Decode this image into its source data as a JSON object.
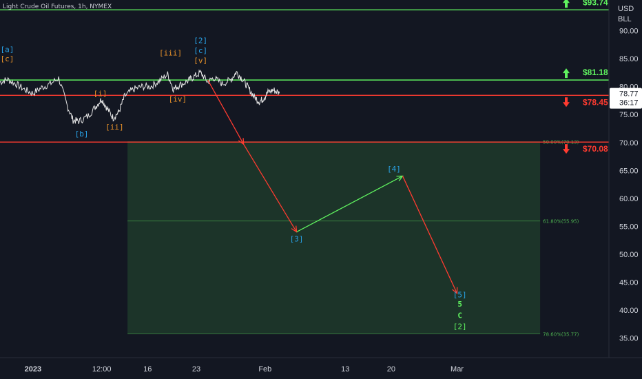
{
  "header": {
    "title": "Light Crude Oil Futures, 1h, NYMEX"
  },
  "price_axis": {
    "currency": "USD",
    "unit": "BLL"
  },
  "current_price": {
    "value": "78.77",
    "countdown": "36:17"
  },
  "colors": {
    "bg": "#131722",
    "green": "#5ff25f",
    "red": "#ff3b30",
    "blue": "#29a3e8",
    "orange": "#e7912a",
    "price": "#d1d4dc",
    "zone": "#1f3a2a"
  },
  "chart_data": {
    "type": "line",
    "ylim": [
      31.5,
      95.5
    ],
    "yticks": [
      35,
      40,
      45,
      50,
      55,
      60,
      65,
      70,
      75,
      80,
      85,
      90
    ],
    "xticks": [
      {
        "x": 0.6,
        "label": "2023"
      },
      {
        "x": 3.0,
        "label": "12:00"
      },
      {
        "x": 4.6,
        "label": "16"
      },
      {
        "x": 6.3,
        "label": "23"
      },
      {
        "x": 8.7,
        "label": "Feb"
      },
      {
        "x": 11.5,
        "label": "13"
      },
      {
        "x": 13.1,
        "label": "20"
      },
      {
        "x": 15.4,
        "label": "Mar"
      }
    ],
    "xlim": [
      -0.55,
      20.7
    ],
    "price_series": [
      [
        -0.55,
        80.8
      ],
      [
        -0.3,
        81.3
      ],
      [
        0.0,
        80.5
      ],
      [
        0.3,
        79.5
      ],
      [
        0.6,
        78.8
      ],
      [
        0.9,
        79.8
      ],
      [
        1.2,
        80.5
      ],
      [
        1.5,
        81.5
      ],
      [
        1.8,
        76.5
      ],
      [
        2.0,
        74.0
      ],
      [
        2.2,
        73.8
      ],
      [
        2.5,
        74.6
      ],
      [
        2.8,
        76.5
      ],
      [
        3.0,
        77.8
      ],
      [
        3.2,
        76.0
      ],
      [
        3.4,
        74.4
      ],
      [
        3.6,
        75.5
      ],
      [
        3.8,
        78.3
      ],
      [
        4.1,
        79.5
      ],
      [
        4.4,
        80.0
      ],
      [
        4.7,
        80.0
      ],
      [
        5.0,
        81.0
      ],
      [
        5.3,
        82.2
      ],
      [
        5.5,
        79.6
      ],
      [
        5.7,
        80.2
      ],
      [
        6.0,
        81.0
      ],
      [
        6.2,
        81.7
      ],
      [
        6.45,
        82.5
      ],
      [
        6.7,
        80.8
      ],
      [
        6.9,
        81.6
      ],
      [
        7.2,
        80.5
      ],
      [
        7.5,
        81.2
      ],
      [
        7.7,
        82.6
      ],
      [
        7.9,
        81.4
      ],
      [
        8.1,
        79.9
      ],
      [
        8.3,
        78.3
      ],
      [
        8.5,
        77.3
      ],
      [
        8.65,
        77.9
      ],
      [
        8.8,
        79.0
      ],
      [
        9.0,
        79.4
      ],
      [
        9.2,
        78.8
      ]
    ],
    "levels": [
      {
        "value": 93.74,
        "label": "$93.74",
        "color": "green",
        "arrow": "up"
      },
      {
        "value": 81.18,
        "label": "$81.18",
        "color": "green",
        "arrow": "up"
      },
      {
        "value": 78.45,
        "label": "$78.45",
        "color": "red",
        "arrow": "down"
      },
      {
        "value": 70.08,
        "label": "$70.08",
        "color": "red",
        "arrow": "down"
      }
    ],
    "fib_levels": [
      {
        "value": 70.13,
        "label": "50.00%(70.13)"
      },
      {
        "value": 55.95,
        "label": "61.80%(55.95)"
      },
      {
        "value": 35.77,
        "label": "78.60%(35.77)"
      }
    ],
    "target_zone": {
      "x_start": 3.9,
      "x_end": 18.3,
      "top": 70.08,
      "bottom": 35.77
    },
    "projection": [
      {
        "from": [
          6.7,
          81.2
        ],
        "to": [
          7.95,
          69.7
        ],
        "color": "red"
      },
      {
        "from": [
          7.95,
          69.7
        ],
        "to": [
          9.8,
          54.0
        ],
        "color": "red"
      },
      {
        "from": [
          9.8,
          54.0
        ],
        "to": [
          13.5,
          64.0
        ],
        "color": "green"
      },
      {
        "from": [
          13.5,
          64.0
        ],
        "to": [
          15.4,
          43.0
        ],
        "color": "red"
      }
    ],
    "wave_labels": [
      {
        "text": "[a]",
        "x": -0.3,
        "y": 86.2,
        "color": "blue"
      },
      {
        "text": "[c]",
        "x": -0.3,
        "y": 84.5,
        "color": "orange"
      },
      {
        "text": "[b]",
        "x": 2.3,
        "y": 71.1,
        "color": "blue"
      },
      {
        "text": "[i]",
        "x": 2.95,
        "y": 78.3,
        "color": "orange"
      },
      {
        "text": "[ii]",
        "x": 3.45,
        "y": 72.3,
        "color": "orange"
      },
      {
        "text": "[iii]",
        "x": 5.4,
        "y": 85.6,
        "color": "orange"
      },
      {
        "text": "[iv]",
        "x": 5.65,
        "y": 77.3,
        "color": "orange"
      },
      {
        "text": "[2]",
        "x": 6.45,
        "y": 87.8,
        "color": "blue"
      },
      {
        "text": "[c]",
        "x": 6.45,
        "y": 86.0,
        "color": "blue"
      },
      {
        "text": "[v]",
        "x": 6.45,
        "y": 84.2,
        "color": "orange"
      },
      {
        "text": "[3]",
        "x": 9.8,
        "y": 52.3,
        "color": "blue"
      },
      {
        "text": "[4]",
        "x": 13.2,
        "y": 64.8,
        "color": "blue"
      },
      {
        "text": "[5]",
        "x": 15.5,
        "y": 42.3,
        "color": "blue"
      },
      {
        "text": "5",
        "x": 15.5,
        "y": 40.6,
        "color": "green"
      },
      {
        "text": "C",
        "x": 15.5,
        "y": 38.6,
        "color": "green"
      },
      {
        "text": "[2]",
        "x": 15.5,
        "y": 36.6,
        "color": "green"
      }
    ]
  }
}
